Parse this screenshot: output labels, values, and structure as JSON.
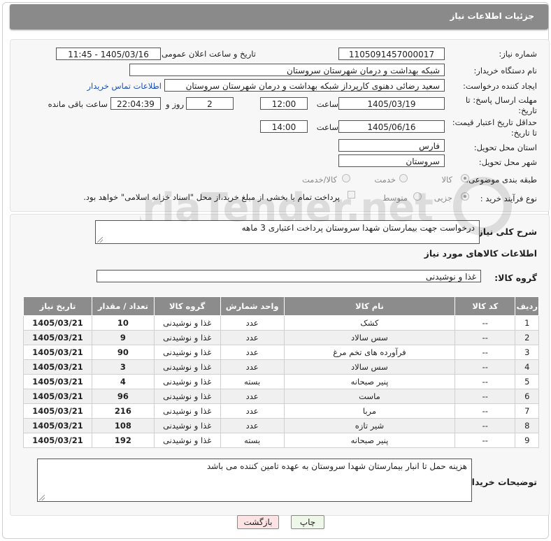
{
  "header": {
    "title": "جزئیات اطلاعات نیاز"
  },
  "form": {
    "need_number_label": "شماره نیاز:",
    "need_number": "1105091457000017",
    "announce_label": "تاریخ و ساعت اعلان عمومی:",
    "announce_value": "1405/03/16 - 11:45",
    "buyer_org_label": "نام دستگاه خریدار:",
    "buyer_org": "شبکه بهداشت و درمان شهرستان سروستان",
    "requester_label": "ایجاد کننده درخواست:",
    "requester": "سعید رضائی دهنوی کارپرداز شبکه بهداشت و درمان شهرستان سروستان",
    "contact_link": "اطلاعات تماس خریدار",
    "deadline_label_1": "مهلت ارسال پاسخ: تا",
    "deadline_label_2": "تاریخ:",
    "deadline_date": "1405/03/19",
    "time_label": "ساعت",
    "deadline_time": "12:00",
    "days_value": "2",
    "days_label": "روز و",
    "remaining_time": "22:04:39",
    "remaining_label": "ساعت باقی مانده",
    "validity_label_1": "حداقل تاریخ اعتبار قیمت:",
    "validity_label_2": "تا تاریخ:",
    "validity_date": "1405/06/16",
    "validity_time": "14:00",
    "province_label": "استان محل تحویل:",
    "province": "فارس",
    "city_label": "شهر محل تحویل:",
    "city": "سروستان",
    "category_label": "طبقه بندی موضوعی:",
    "category_options": [
      "کالا",
      "خدمت",
      "کالا/خدمت"
    ],
    "process_label": "نوع فرآیند خرید :",
    "process_options": [
      "جزیی",
      "متوسط"
    ],
    "payment_note": "پرداخت تمام یا بخشی از مبلغ خرید،از محل \"اسناد خزانه اسلامی\" خواهد بود."
  },
  "details": {
    "desc_label": "شرح کلی نیاز:",
    "desc_value": "درخواست جهت بیمارستان شهدا سروستان پرداخت اعتباری 3 ماهه",
    "items_title": "اطلاعات کالاهای مورد نیاز",
    "group_label": "گروه کالا:",
    "group_value": "غذا و نوشیدنی"
  },
  "table": {
    "headers": [
      "ردیف",
      "کد کالا",
      "نام کالا",
      "واحد شمارش",
      "گروه کالا",
      "تعداد / مقدار",
      "تاریخ نیاز"
    ],
    "rows": [
      [
        "1",
        "--",
        "کشک",
        "عدد",
        "غذا و نوشیدنی",
        "10",
        "1405/03/21"
      ],
      [
        "2",
        "--",
        "سس سالاد",
        "عدد",
        "غذا و نوشیدنی",
        "9",
        "1405/03/21"
      ],
      [
        "3",
        "--",
        "فرآورده های تخم مرغ",
        "عدد",
        "غذا و نوشیدنی",
        "90",
        "1405/03/21"
      ],
      [
        "4",
        "--",
        "سس سالاد",
        "عدد",
        "غذا و نوشیدنی",
        "3",
        "1405/03/21"
      ],
      [
        "5",
        "--",
        "پنیر صبحانه",
        "بسته",
        "غذا و نوشیدنی",
        "4",
        "1405/03/21"
      ],
      [
        "6",
        "--",
        "ماست",
        "عدد",
        "غذا و نوشیدنی",
        "96",
        "1405/03/21"
      ],
      [
        "7",
        "--",
        "مربا",
        "عدد",
        "غذا و نوشیدنی",
        "216",
        "1405/03/21"
      ],
      [
        "8",
        "--",
        "شیر تازه",
        "عدد",
        "غذا و نوشیدنی",
        "108",
        "1405/03/21"
      ],
      [
        "9",
        "--",
        "پنیر صبحانه",
        "بسته",
        "غذا و نوشیدنی",
        "192",
        "1405/03/21"
      ]
    ]
  },
  "buyer_notes": {
    "label": "توضیحات خریدار:",
    "value": "هزینه حمل تا انبار بیمارستان شهدا سروستان به عهده تامین کننده می باشد"
  },
  "buttons": {
    "print": "چاپ",
    "back": "بازگشت"
  },
  "watermark": {
    "text": "AriaTender.net"
  },
  "colors": {
    "header_bg": "#8a8a8a",
    "link": "#1a4fb8",
    "back_btn": "#fde3e3",
    "print_btn": "#eef7e8"
  }
}
